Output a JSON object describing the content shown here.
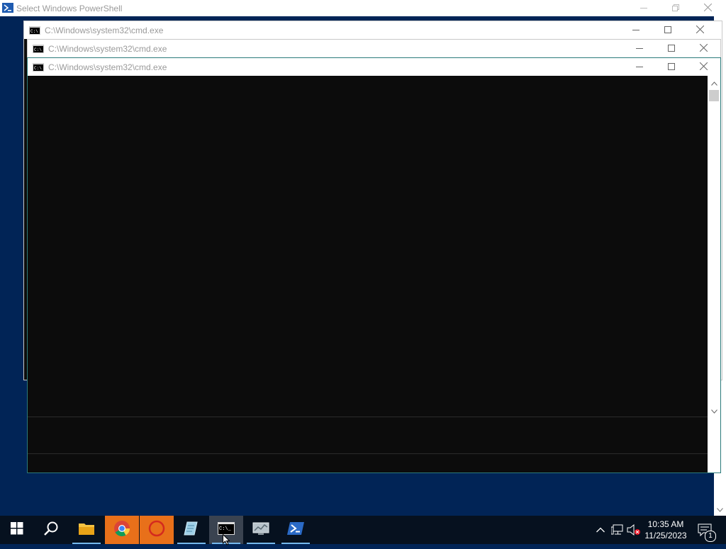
{
  "powershell_window": {
    "title": "Select Windows PowerShell"
  },
  "cmd_windows": [
    {
      "title": "C:\\Windows\\system32\\cmd.exe"
    },
    {
      "title": "C:\\Windows\\system32\\cmd.exe"
    },
    {
      "title": "C:\\Windows\\system32\\cmd.exe"
    }
  ],
  "taskbar": {
    "items": [
      {
        "icon": "windows-start-icon"
      },
      {
        "icon": "search-icon"
      },
      {
        "icon": "file-explorer-icon"
      },
      {
        "icon": "chrome-icon"
      },
      {
        "icon": "red-circle-app-icon"
      },
      {
        "icon": "notepad-icon"
      },
      {
        "icon": "cmd-icon",
        "active": true
      },
      {
        "icon": "server-manager-icon"
      },
      {
        "icon": "powershell-icon"
      }
    ],
    "tray": {
      "time": "10:35 AM",
      "date": "11/25/2023",
      "notification_count": "1"
    }
  },
  "colors": {
    "desktop_bg": "#012456",
    "console_bg": "#0c0c0c",
    "taskbar_bg": "#06111f",
    "chrome_highlight": "#e8701a"
  }
}
